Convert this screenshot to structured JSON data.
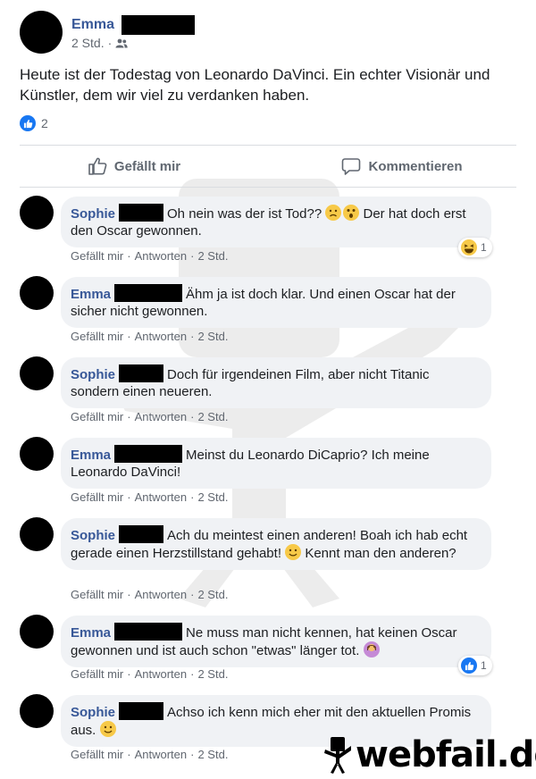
{
  "post": {
    "author": "Emma",
    "time": "2 Std.",
    "privacy_icon": "friends-icon",
    "text": "Heute ist der Todestag von Leonardo DaVinci. Ein echter Visionär und Künstler, dem wir viel zu verdanken haben.",
    "reaction_count": "2",
    "actions": {
      "like": "Gefällt mir",
      "comment": "Kommentieren"
    }
  },
  "comment_meta": {
    "like": "Gefällt mir",
    "reply": "Antworten",
    "sep": "·"
  },
  "comments": [
    {
      "author": "Sophie",
      "text_before": "Oh nein was der ist Tod?? ",
      "text_after": " Der hat doch erst den Oscar gewonnen.",
      "time": "2 Std.",
      "reaction": "haha",
      "reaction_count": "1"
    },
    {
      "author": "Emma",
      "text": "Ähm ja ist doch klar. Und einen Oscar hat der sicher nicht gewonnen.",
      "time": "2 Std."
    },
    {
      "author": "Sophie",
      "text": "Doch für irgendeinen Film, aber nicht Titanic sondern einen neueren.",
      "time": "2 Std."
    },
    {
      "author": "Emma",
      "text": "Meinst du Leonardo DiCaprio? Ich meine Leonardo DaVinci!",
      "time": "2 Std."
    },
    {
      "author": "Sophie",
      "text_before": "Ach du meintest einen anderen! Boah ich hab echt gerade einen Herzstillstand gehabt! ",
      "text_after": " Kennt man den anderen?",
      "time": "2 Std."
    },
    {
      "author": "Emma",
      "text_before": "Ne muss man nicht kennen, hat keinen Oscar gewonnen und ist auch schon \"etwas\" länger tot. ",
      "time": "2 Std.",
      "reaction": "like",
      "reaction_count": "1"
    },
    {
      "author": "Sophie",
      "text_before": "Achso ich kenn mich eher mit den aktuellen Promis aus. ",
      "time": "2 Std."
    }
  ],
  "brand": "webfail.de",
  "colors": {
    "link": "#385898",
    "bubble": "#f0f2f5",
    "like_blue": "#1877f2"
  }
}
